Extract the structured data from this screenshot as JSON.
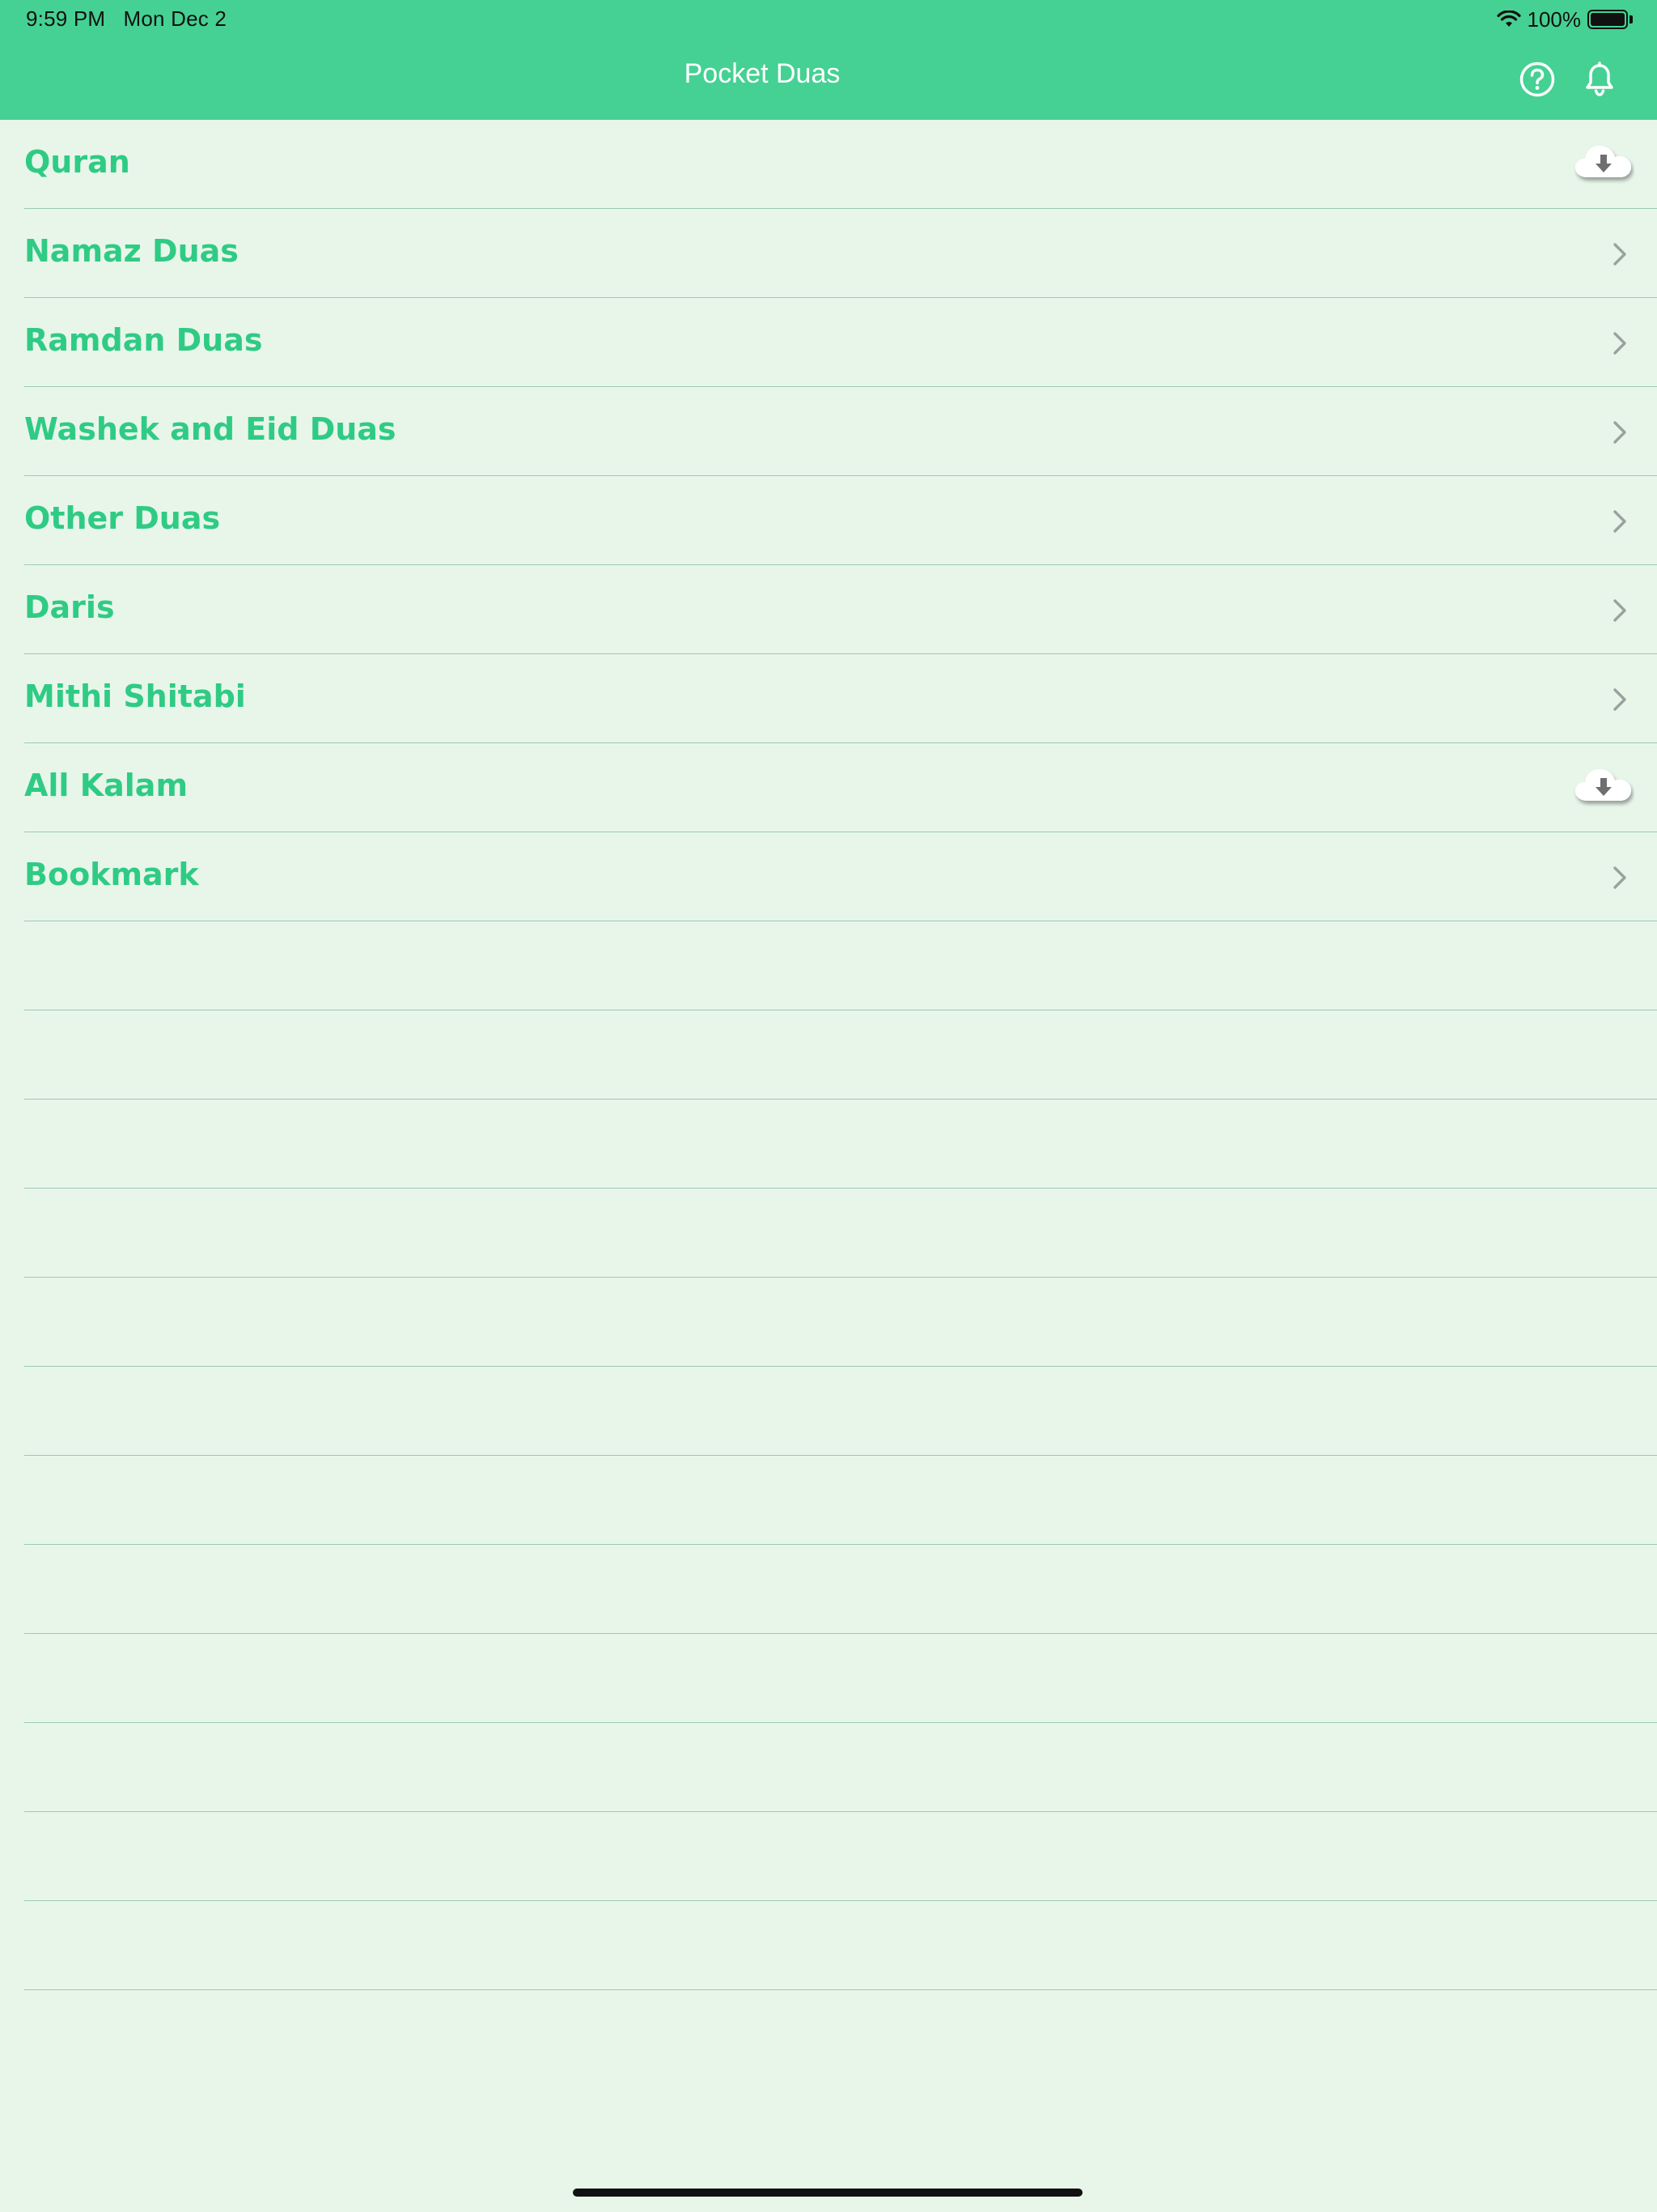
{
  "status_bar": {
    "time": "9:59 PM",
    "date": "Mon Dec 2",
    "battery": "100%",
    "wifi_icon": "wifi-icon",
    "battery_icon": "battery-icon"
  },
  "nav": {
    "title": "Pocket Duas",
    "help_icon": "question-circle-icon",
    "bell_icon": "bell-icon"
  },
  "colors": {
    "header": "#45d193",
    "background": "#e8f6ea",
    "label": "#2fcb84",
    "separator": "#9bc9b1"
  },
  "list": {
    "items": [
      {
        "label": "Quran",
        "accessory": "cloud-download-icon"
      },
      {
        "label": "Namaz Duas",
        "accessory": "chevron-right-icon"
      },
      {
        "label": "Ramdan Duas",
        "accessory": "chevron-right-icon"
      },
      {
        "label": "Washek and Eid Duas",
        "accessory": "chevron-right-icon"
      },
      {
        "label": "Other Duas",
        "accessory": "chevron-right-icon"
      },
      {
        "label": "Daris",
        "accessory": "chevron-right-icon"
      },
      {
        "label": "Mithi Shitabi",
        "accessory": "chevron-right-icon"
      },
      {
        "label": "All Kalam",
        "accessory": "cloud-download-icon"
      },
      {
        "label": "Bookmark",
        "accessory": "chevron-right-icon"
      }
    ],
    "empty_row_count": 12
  }
}
